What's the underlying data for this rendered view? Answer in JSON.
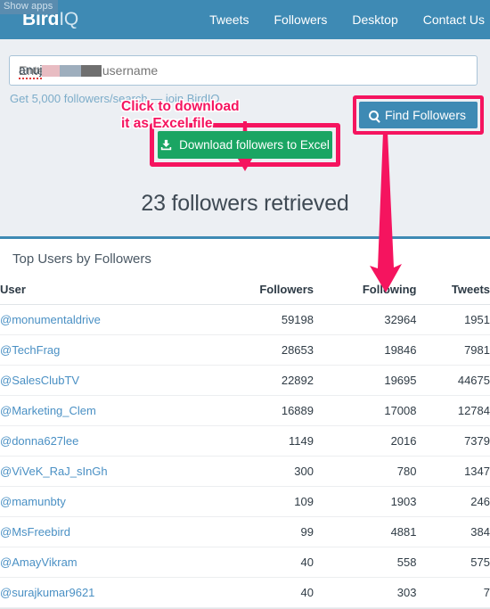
{
  "browser": {
    "show_apps_label": "Show apps"
  },
  "navbar": {
    "brand_bold": "Bird",
    "brand_light": "IQ",
    "links": [
      {
        "label": "Tweets"
      },
      {
        "label": "Followers"
      },
      {
        "label": "Desktop"
      },
      {
        "label": "Contact Us"
      }
    ]
  },
  "search": {
    "value_visible": "anuj",
    "placeholder": "Enter a Twitter username",
    "note": "Get 5,000 followers/search — join BirdIQ",
    "find_button_label": "Find Followers",
    "find_button_icon": "search-icon"
  },
  "annotations": {
    "download_hint_line1": "Click to download",
    "download_hint_line2": "it as Excel file",
    "accent_color": "#f5145f"
  },
  "download": {
    "button_label": "Download followers to Excel",
    "button_icon": "download-icon",
    "button_color": "#1aa563"
  },
  "results": {
    "retrieved_heading": "23 followers retrieved",
    "panel_title": "Top Users by Followers",
    "columns": [
      "User",
      "Followers",
      "Following",
      "Tweets"
    ],
    "rows": [
      {
        "user": "@monumentaldrive",
        "followers": "59198",
        "following": "32964",
        "tweets": "1951"
      },
      {
        "user": "@TechFrag",
        "followers": "28653",
        "following": "19846",
        "tweets": "7981"
      },
      {
        "user": "@SalesClubTV",
        "followers": "22892",
        "following": "19695",
        "tweets": "44675"
      },
      {
        "user": "@Marketing_Clem",
        "followers": "16889",
        "following": "17008",
        "tweets": "12784"
      },
      {
        "user": "@donna627lee",
        "followers": "1149",
        "following": "2016",
        "tweets": "7379"
      },
      {
        "user": "@ViVeK_RaJ_sInGh",
        "followers": "300",
        "following": "780",
        "tweets": "1347"
      },
      {
        "user": "@mamunbty",
        "followers": "109",
        "following": "1903",
        "tweets": "246"
      },
      {
        "user": "@MsFreebird",
        "followers": "99",
        "following": "4881",
        "tweets": "384"
      },
      {
        "user": "@AmayVikram",
        "followers": "40",
        "following": "558",
        "tweets": "575"
      },
      {
        "user": "@surajkumar9621",
        "followers": "40",
        "following": "303",
        "tweets": "7"
      }
    ]
  },
  "theme": {
    "nav_blue": "#3e8ab4",
    "page_bg": "#eceff3",
    "link_blue": "#4a90c4"
  }
}
